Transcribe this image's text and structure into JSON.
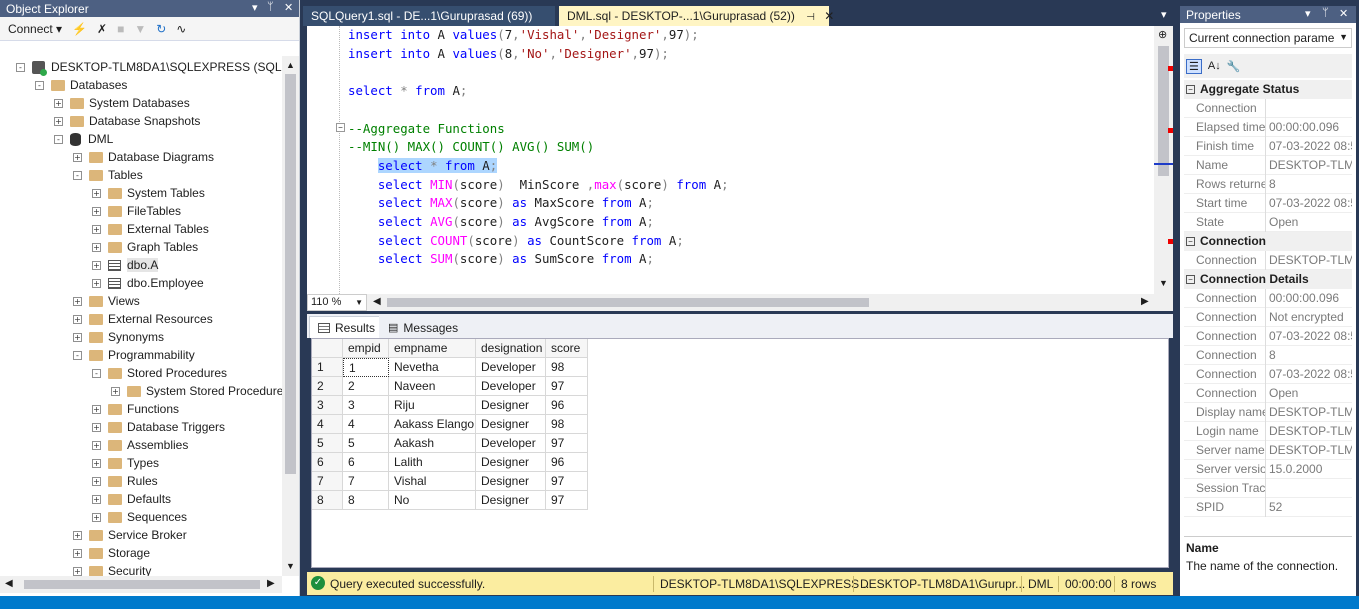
{
  "object_explorer": {
    "title": "Object Explorer",
    "toolbar": {
      "connect": "Connect"
    },
    "tree": [
      {
        "label": "DESKTOP-TLM8DA1\\SQLEXPRESS (SQL Serv",
        "icon": "server-icon",
        "indent": 0,
        "exp": "-"
      },
      {
        "label": "Databases",
        "icon": "folder-icon",
        "indent": 1,
        "exp": "-"
      },
      {
        "label": "System Databases",
        "icon": "folder-icon",
        "indent": 2,
        "exp": "+"
      },
      {
        "label": "Database Snapshots",
        "icon": "folder-icon",
        "indent": 2,
        "exp": "+"
      },
      {
        "label": "DML",
        "icon": "database-icon",
        "indent": 2,
        "exp": "-"
      },
      {
        "label": "Database Diagrams",
        "icon": "folder-icon",
        "indent": 3,
        "exp": "+"
      },
      {
        "label": "Tables",
        "icon": "folder-icon",
        "indent": 3,
        "exp": "-"
      },
      {
        "label": "System Tables",
        "icon": "folder-icon",
        "indent": 4,
        "exp": "+"
      },
      {
        "label": "FileTables",
        "icon": "folder-icon",
        "indent": 4,
        "exp": "+"
      },
      {
        "label": "External Tables",
        "icon": "folder-icon",
        "indent": 4,
        "exp": "+"
      },
      {
        "label": "Graph Tables",
        "icon": "folder-icon",
        "indent": 4,
        "exp": "+"
      },
      {
        "label": "dbo.A",
        "icon": "table-icon",
        "indent": 4,
        "exp": "+"
      },
      {
        "label": "dbo.Employee",
        "icon": "table-icon",
        "indent": 4,
        "exp": "+"
      },
      {
        "label": "Views",
        "icon": "folder-icon",
        "indent": 3,
        "exp": "+"
      },
      {
        "label": "External Resources",
        "icon": "folder-icon",
        "indent": 3,
        "exp": "+"
      },
      {
        "label": "Synonyms",
        "icon": "folder-icon",
        "indent": 3,
        "exp": "+"
      },
      {
        "label": "Programmability",
        "icon": "folder-icon",
        "indent": 3,
        "exp": "-"
      },
      {
        "label": "Stored Procedures",
        "icon": "folder-icon",
        "indent": 4,
        "exp": "-"
      },
      {
        "label": "System Stored Procedure",
        "icon": "folder-icon",
        "indent": 5,
        "exp": "+"
      },
      {
        "label": "Functions",
        "icon": "folder-icon",
        "indent": 4,
        "exp": "+"
      },
      {
        "label": "Database Triggers",
        "icon": "folder-icon",
        "indent": 4,
        "exp": "+"
      },
      {
        "label": "Assemblies",
        "icon": "folder-icon",
        "indent": 4,
        "exp": "+"
      },
      {
        "label": "Types",
        "icon": "folder-icon",
        "indent": 4,
        "exp": "+"
      },
      {
        "label": "Rules",
        "icon": "folder-icon",
        "indent": 4,
        "exp": "+"
      },
      {
        "label": "Defaults",
        "icon": "folder-icon",
        "indent": 4,
        "exp": "+"
      },
      {
        "label": "Sequences",
        "icon": "folder-icon",
        "indent": 4,
        "exp": "+"
      },
      {
        "label": "Service Broker",
        "icon": "folder-icon",
        "indent": 3,
        "exp": "+"
      },
      {
        "label": "Storage",
        "icon": "folder-icon",
        "indent": 3,
        "exp": "+"
      },
      {
        "label": "Security",
        "icon": "folder-icon",
        "indent": 3,
        "exp": "+"
      }
    ]
  },
  "tabs": [
    {
      "label": "SQLQuery1.sql - DE...1\\Guruprasad (69))",
      "active": false
    },
    {
      "label": "DML.sql - DESKTOP-...1\\Guruprasad (52))",
      "active": true
    }
  ],
  "editor": {
    "zoom": "110 %",
    "lines": [
      [
        [
          "kw",
          "insert into "
        ],
        [
          "",
          "A "
        ],
        [
          "kw",
          "values"
        ],
        [
          "gr",
          "("
        ],
        [
          "",
          "7"
        ],
        [
          "gr",
          ","
        ],
        [
          "str",
          "'Vishal'"
        ],
        [
          "gr",
          ","
        ],
        [
          "str",
          "'Designer'"
        ],
        [
          "gr",
          ","
        ],
        [
          "",
          "97"
        ],
        [
          "gr",
          ");"
        ]
      ],
      [
        [
          "kw",
          "insert into "
        ],
        [
          "",
          "A "
        ],
        [
          "kw",
          "values"
        ],
        [
          "gr",
          "("
        ],
        [
          "",
          "8"
        ],
        [
          "gr",
          ","
        ],
        [
          "str",
          "'No'"
        ],
        [
          "gr",
          ","
        ],
        [
          "str",
          "'Designer'"
        ],
        [
          "gr",
          ","
        ],
        [
          "",
          "97"
        ],
        [
          "gr",
          ");"
        ]
      ],
      [],
      [
        [
          "kw",
          "select "
        ],
        [
          "gr",
          "* "
        ],
        [
          "kw",
          "from "
        ],
        [
          "",
          "A"
        ],
        [
          "gr",
          ";"
        ]
      ],
      [],
      [
        [
          "cm",
          "--Aggregate Functions"
        ]
      ],
      [
        [
          "cm",
          "--MIN() MAX() COUNT() AVG() SUM()"
        ]
      ],
      [
        [
          "sel",
          "    "
        ],
        [
          "sel-kw",
          "select "
        ],
        [
          "sel-gr",
          "* "
        ],
        [
          "sel-kw",
          "from "
        ],
        [
          "sel",
          "A"
        ],
        [
          "sel-gr",
          ";"
        ]
      ],
      [
        [
          "",
          "    "
        ],
        [
          "kw",
          "select "
        ],
        [
          "fn",
          "MIN"
        ],
        [
          "gr",
          "("
        ],
        [
          "",
          "score"
        ],
        [
          "gr",
          ")  "
        ],
        [
          "",
          "MinScore "
        ],
        [
          "gr",
          ","
        ],
        [
          "fn",
          "max"
        ],
        [
          "gr",
          "("
        ],
        [
          "",
          "score"
        ],
        [
          "gr",
          ") "
        ],
        [
          "kw",
          "from "
        ],
        [
          "",
          "A"
        ],
        [
          "gr",
          ";"
        ]
      ],
      [
        [
          "",
          "    "
        ],
        [
          "kw",
          "select "
        ],
        [
          "fn",
          "MAX"
        ],
        [
          "gr",
          "("
        ],
        [
          "",
          "score"
        ],
        [
          "gr",
          ") "
        ],
        [
          "kw",
          "as "
        ],
        [
          "",
          "MaxScore "
        ],
        [
          "kw",
          "from "
        ],
        [
          "",
          "A"
        ],
        [
          "gr",
          ";"
        ]
      ],
      [
        [
          "",
          "    "
        ],
        [
          "kw",
          "select "
        ],
        [
          "fn",
          "AVG"
        ],
        [
          "gr",
          "("
        ],
        [
          "",
          "score"
        ],
        [
          "gr",
          ") "
        ],
        [
          "kw",
          "as "
        ],
        [
          "",
          "AvgScore "
        ],
        [
          "kw",
          "from "
        ],
        [
          "",
          "A"
        ],
        [
          "gr",
          ";"
        ]
      ],
      [
        [
          "",
          "    "
        ],
        [
          "kw",
          "select "
        ],
        [
          "fn",
          "COUNT"
        ],
        [
          "gr",
          "("
        ],
        [
          "",
          "score"
        ],
        [
          "gr",
          ") "
        ],
        [
          "kw",
          "as "
        ],
        [
          "",
          "CountScore "
        ],
        [
          "kw",
          "from "
        ],
        [
          "",
          "A"
        ],
        [
          "gr",
          ";"
        ]
      ],
      [
        [
          "",
          "    "
        ],
        [
          "kw",
          "select "
        ],
        [
          "fn",
          "SUM"
        ],
        [
          "gr",
          "("
        ],
        [
          "",
          "score"
        ],
        [
          "gr",
          ") "
        ],
        [
          "kw",
          "as "
        ],
        [
          "",
          "SumScore "
        ],
        [
          "kw",
          "from "
        ],
        [
          "",
          "A"
        ],
        [
          "gr",
          ";"
        ]
      ]
    ]
  },
  "results": {
    "tabs": {
      "results": "Results",
      "messages": "Messages"
    },
    "columns": [
      "",
      "empid",
      "empname",
      "designation",
      "score"
    ],
    "rows": [
      [
        "1",
        "1",
        "Nevetha",
        "Developer",
        "98"
      ],
      [
        "2",
        "2",
        "Naveen",
        "Developer",
        "97"
      ],
      [
        "3",
        "3",
        "Riju",
        "Designer",
        "96"
      ],
      [
        "4",
        "4",
        "Aakass Elango",
        "Designer",
        "98"
      ],
      [
        "5",
        "5",
        "Aakash",
        "Developer",
        "97"
      ],
      [
        "6",
        "6",
        "Lalith",
        "Designer",
        "96"
      ],
      [
        "7",
        "7",
        "Vishal",
        "Designer",
        "97"
      ],
      [
        "8",
        "8",
        "No",
        "Designer",
        "97"
      ]
    ]
  },
  "status": {
    "message": "Query executed successfully.",
    "server": "DESKTOP-TLM8DA1\\SQLEXPRESS ...",
    "user": "DESKTOP-TLM8DA1\\Gurupr...",
    "database": "DML",
    "elapsed": "00:00:00",
    "rows": "8 rows"
  },
  "properties": {
    "title": "Properties",
    "selector": "Current connection parame",
    "sections": [
      {
        "name": "Aggregate Status",
        "items": [
          [
            "Connection",
            ""
          ],
          [
            "Elapsed time",
            "00:00:00.096"
          ],
          [
            "Finish time",
            "07-03-2022 08:5"
          ],
          [
            "Name",
            "DESKTOP-TLM8I"
          ],
          [
            "Rows returned",
            "8"
          ],
          [
            "Start time",
            "07-03-2022 08:5"
          ],
          [
            "State",
            "Open"
          ]
        ]
      },
      {
        "name": "Connection",
        "items": [
          [
            "Connection",
            "DESKTOP-TLM8I"
          ]
        ]
      },
      {
        "name": "Connection Details",
        "items": [
          [
            "Connection",
            "00:00:00.096"
          ],
          [
            "Connection",
            "Not encrypted"
          ],
          [
            "Connection",
            "07-03-2022 08:5"
          ],
          [
            "Connection",
            "8"
          ],
          [
            "Connection",
            "07-03-2022 08:5"
          ],
          [
            "Connection",
            "Open"
          ],
          [
            "Display name",
            "DESKTOP-TLM8I"
          ],
          [
            "Login name",
            "DESKTOP-TLM8I"
          ],
          [
            "Server name",
            "DESKTOP-TLM8I"
          ],
          [
            "Server version",
            "15.0.2000"
          ],
          [
            "Session Trac",
            ""
          ],
          [
            "SPID",
            "52"
          ]
        ]
      }
    ],
    "desc_title": "Name",
    "desc_text": "The name of the connection."
  }
}
